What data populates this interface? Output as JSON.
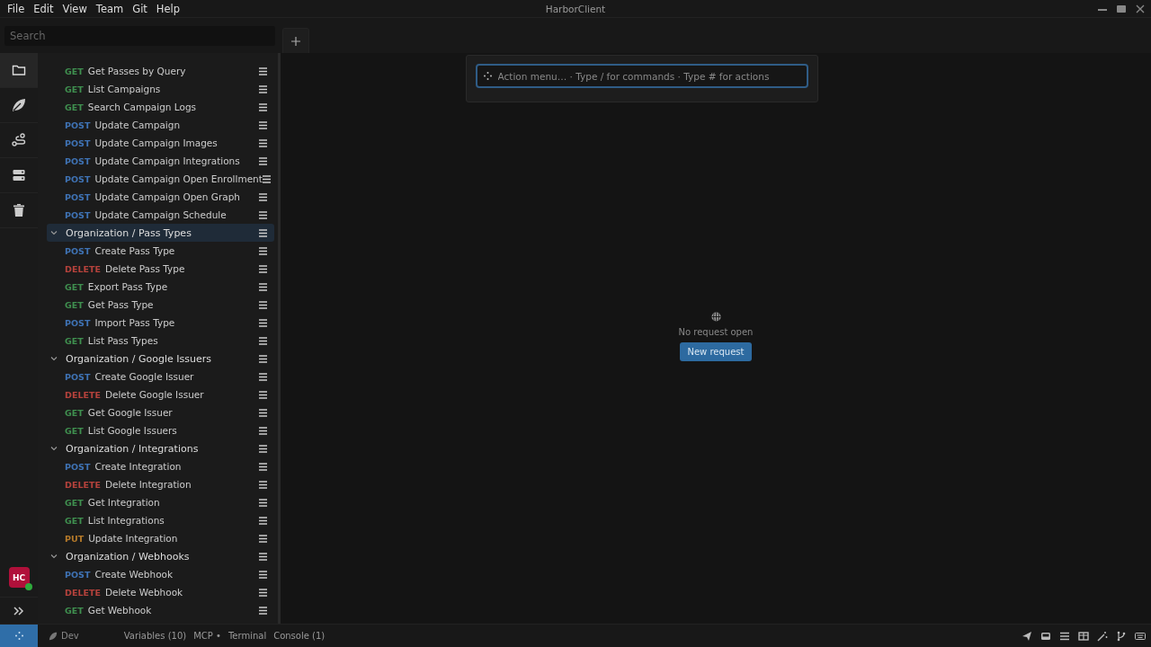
{
  "window": {
    "title": "HarborClient"
  },
  "menu": [
    "File",
    "Edit",
    "View",
    "Team",
    "Git",
    "Help"
  ],
  "search": {
    "placeholder": "Search"
  },
  "activity": [
    {
      "kind": "folder",
      "selected": true
    },
    {
      "kind": "leaf",
      "selected": false
    },
    {
      "kind": "route",
      "selected": false
    },
    {
      "kind": "server",
      "selected": false
    },
    {
      "kind": "trash",
      "selected": false
    }
  ],
  "avatar": {
    "initials": "HC",
    "online": true
  },
  "tree": [
    {
      "kind": "request",
      "method": "GET",
      "color": "#3f8f4f",
      "name": "Get Passes by Query"
    },
    {
      "kind": "request",
      "method": "GET",
      "color": "#3f8f4f",
      "name": "List Campaigns"
    },
    {
      "kind": "request",
      "method": "GET",
      "color": "#3f8f4f",
      "name": "Search Campaign Logs"
    },
    {
      "kind": "request",
      "method": "POST",
      "color": "#3f73b5",
      "name": "Update Campaign"
    },
    {
      "kind": "request",
      "method": "POST",
      "color": "#3f73b5",
      "name": "Update Campaign Images"
    },
    {
      "kind": "request",
      "method": "POST",
      "color": "#3f73b5",
      "name": "Update Campaign Integrations"
    },
    {
      "kind": "request",
      "method": "POST",
      "color": "#3f73b5",
      "name": "Update Campaign Open Enrollment"
    },
    {
      "kind": "request",
      "method": "POST",
      "color": "#3f73b5",
      "name": "Update Campaign Open Graph"
    },
    {
      "kind": "request",
      "method": "POST",
      "color": "#3f73b5",
      "name": "Update Campaign Schedule"
    },
    {
      "kind": "folder",
      "name": "Organization / Pass Types",
      "expanded": true,
      "selected": true,
      "children": [
        {
          "kind": "request",
          "method": "POST",
          "color": "#3f73b5",
          "name": "Create Pass Type"
        },
        {
          "kind": "request",
          "method": "DELETE",
          "color": "#b5423c",
          "name": "Delete Pass Type"
        },
        {
          "kind": "request",
          "method": "GET",
          "color": "#3f8f4f",
          "name": "Export Pass Type"
        },
        {
          "kind": "request",
          "method": "GET",
          "color": "#3f8f4f",
          "name": "Get Pass Type"
        },
        {
          "kind": "request",
          "method": "POST",
          "color": "#3f73b5",
          "name": "Import Pass Type"
        },
        {
          "kind": "request",
          "method": "GET",
          "color": "#3f8f4f",
          "name": "List Pass Types"
        }
      ]
    },
    {
      "kind": "folder",
      "name": "Organization / Google Issuers",
      "expanded": true,
      "selected": false,
      "children": [
        {
          "kind": "request",
          "method": "POST",
          "color": "#3f73b5",
          "name": "Create Google Issuer"
        },
        {
          "kind": "request",
          "method": "DELETE",
          "color": "#b5423c",
          "name": "Delete Google Issuer"
        },
        {
          "kind": "request",
          "method": "GET",
          "color": "#3f8f4f",
          "name": "Get Google Issuer"
        },
        {
          "kind": "request",
          "method": "GET",
          "color": "#3f8f4f",
          "name": "List Google Issuers"
        }
      ]
    },
    {
      "kind": "folder",
      "name": "Organization / Integrations",
      "expanded": true,
      "selected": false,
      "children": [
        {
          "kind": "request",
          "method": "POST",
          "color": "#3f73b5",
          "name": "Create Integration"
        },
        {
          "kind": "request",
          "method": "DELETE",
          "color": "#b5423c",
          "name": "Delete Integration"
        },
        {
          "kind": "request",
          "method": "GET",
          "color": "#3f8f4f",
          "name": "Get Integration"
        },
        {
          "kind": "request",
          "method": "GET",
          "color": "#3f8f4f",
          "name": "List Integrations"
        },
        {
          "kind": "request",
          "method": "PUT",
          "color": "#b57a2a",
          "name": "Update Integration"
        }
      ]
    },
    {
      "kind": "folder",
      "name": "Organization / Webhooks",
      "expanded": true,
      "selected": false,
      "children": [
        {
          "kind": "request",
          "method": "POST",
          "color": "#3f73b5",
          "name": "Create Webhook"
        },
        {
          "kind": "request",
          "method": "DELETE",
          "color": "#b5423c",
          "name": "Delete Webhook"
        },
        {
          "kind": "request",
          "method": "GET",
          "color": "#3f8f4f",
          "name": "Get Webhook"
        }
      ]
    }
  ],
  "command": {
    "placeholder": "Action menu… · Type / for commands · Type # for actions"
  },
  "empty": {
    "message": "No request open",
    "button": "New request"
  },
  "status_bar": {
    "environment": "Dev",
    "items": [
      "Variables (10)",
      "MCP •",
      "Terminal",
      "Console (1)"
    ]
  }
}
